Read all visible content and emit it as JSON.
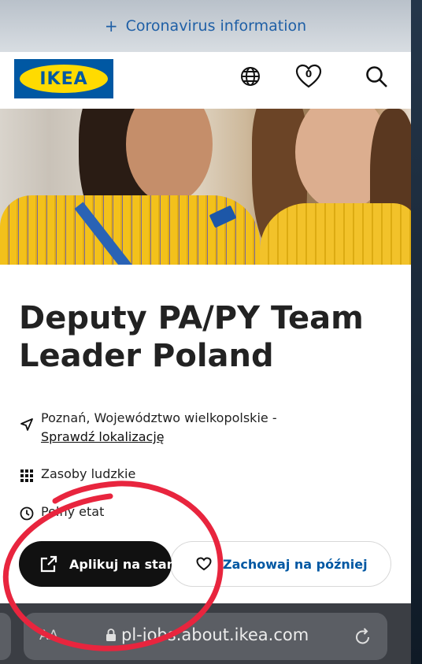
{
  "banner": {
    "plus_icon": "+",
    "text": "Coronavirus information"
  },
  "header": {
    "logo_text": "IKEA",
    "icons": [
      "globe-icon",
      "heart-icon",
      "search-icon"
    ],
    "favorites_count": "0"
  },
  "job": {
    "title": "Deputy PA/PY Team Leader Poland",
    "location": "Poznań, Województwo wielkopolskie -",
    "location_link": "Sprawdź lokalizację",
    "department": "Zasoby ludzkie",
    "employment": "Pełny etat"
  },
  "actions": {
    "apply_label": "Aplikuj na stanowisko",
    "save_label": "Zachowaj na później"
  },
  "browser": {
    "aa_label": "AA",
    "url": "pl-jobs.about.ikea.com"
  },
  "colors": {
    "ikea_blue": "#0058a3",
    "ikea_yellow": "#ffdb00",
    "annotation_red": "#e8253e"
  }
}
